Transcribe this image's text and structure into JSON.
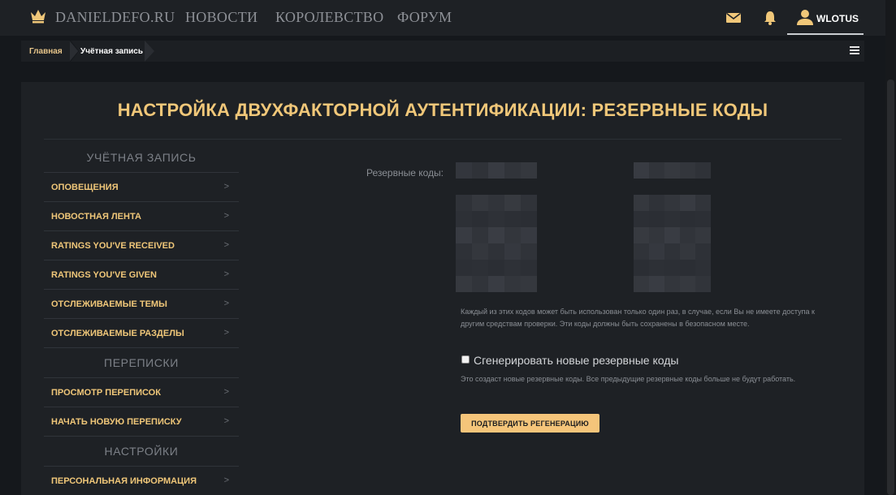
{
  "nav": {
    "brand": "DANIELDEFO.RU",
    "links": [
      "НОВОСТИ",
      "КОРОЛЕВСТВО",
      "ФОРУМ"
    ],
    "user": "WLOTUS"
  },
  "breadcrumb": {
    "home": "Главная",
    "current": "Учётная запись"
  },
  "page": {
    "title": "НАСТРОЙКА ДВУХФАКТОРНОЙ АУТЕНТИФИКАЦИИ: РЕЗЕРВНЫЕ КОДЫ"
  },
  "side": {
    "sections": [
      {
        "heading": "УЧЁТНАЯ ЗАПИСЬ",
        "items": [
          "ОПОВЕЩЕНИЯ",
          "НОВОСТНАЯ ЛЕНТА",
          "RATINGS YOU'VE RECEIVED",
          "RATINGS YOU'VE GIVEN",
          "ОТСЛЕЖИВАЕМЫЕ ТЕМЫ",
          "ОТСЛЕЖИВАЕМЫЕ РАЗДЕЛЫ"
        ]
      },
      {
        "heading": "ПЕРЕПИСКИ",
        "items": [
          "ПРОСМОТР ПЕРЕПИСОК",
          "НАЧАТЬ НОВУЮ ПЕРЕПИСКУ"
        ]
      },
      {
        "heading": "НАСТРОЙКИ",
        "items": [
          "ПЕРСОНАЛЬНАЯ ИНФОРМАЦИЯ"
        ]
      }
    ],
    "arrow": ">"
  },
  "codes": {
    "label": "Резервные коды:",
    "help": "Каждый из этих кодов может быть использован только один раз, в случае, если Вы не имеете доступа к другим средствам проверки. Эти коды должны быть сохранены в безопасном месте.",
    "regenerate_label": "Сгенерировать новые резервные коды",
    "regenerate_help": "Это создаст новые резервные коды. Все предыдущие резервные коды больше не будут работать.",
    "confirm_button": "ПОДТВЕРДИТЬ РЕГЕНЕРАЦИЮ"
  },
  "colors": {
    "accent": "#f0c779",
    "button": "#f5c57a",
    "panel": "#1e2125",
    "background": "#15181c"
  }
}
